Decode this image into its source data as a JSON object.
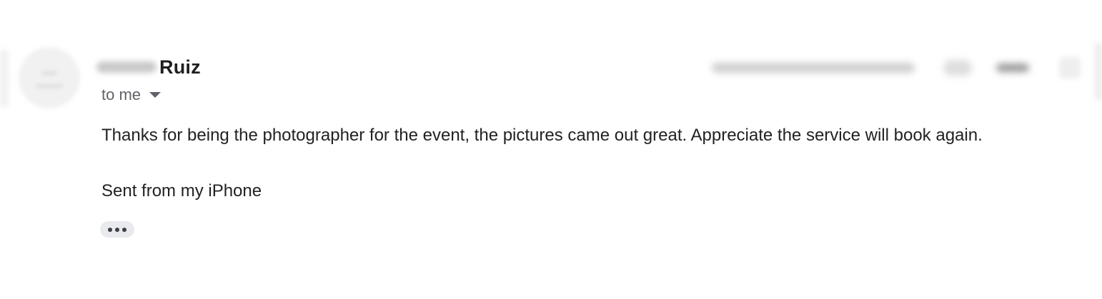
{
  "message": {
    "sender": {
      "last_name": "Ruiz"
    },
    "recipient_label": "to me",
    "body": "Thanks for being the photographer for the event, the pictures came out great. Appreciate the service will book again.",
    "signature": "Sent from my iPhone"
  },
  "icons": {
    "recipient_toggle": "caret-down-icon",
    "trimmed_content": "ellipsis-icon"
  },
  "colors": {
    "text_primary": "#222222",
    "text_secondary": "#5f6368",
    "chip_background": "#e8eaed"
  }
}
